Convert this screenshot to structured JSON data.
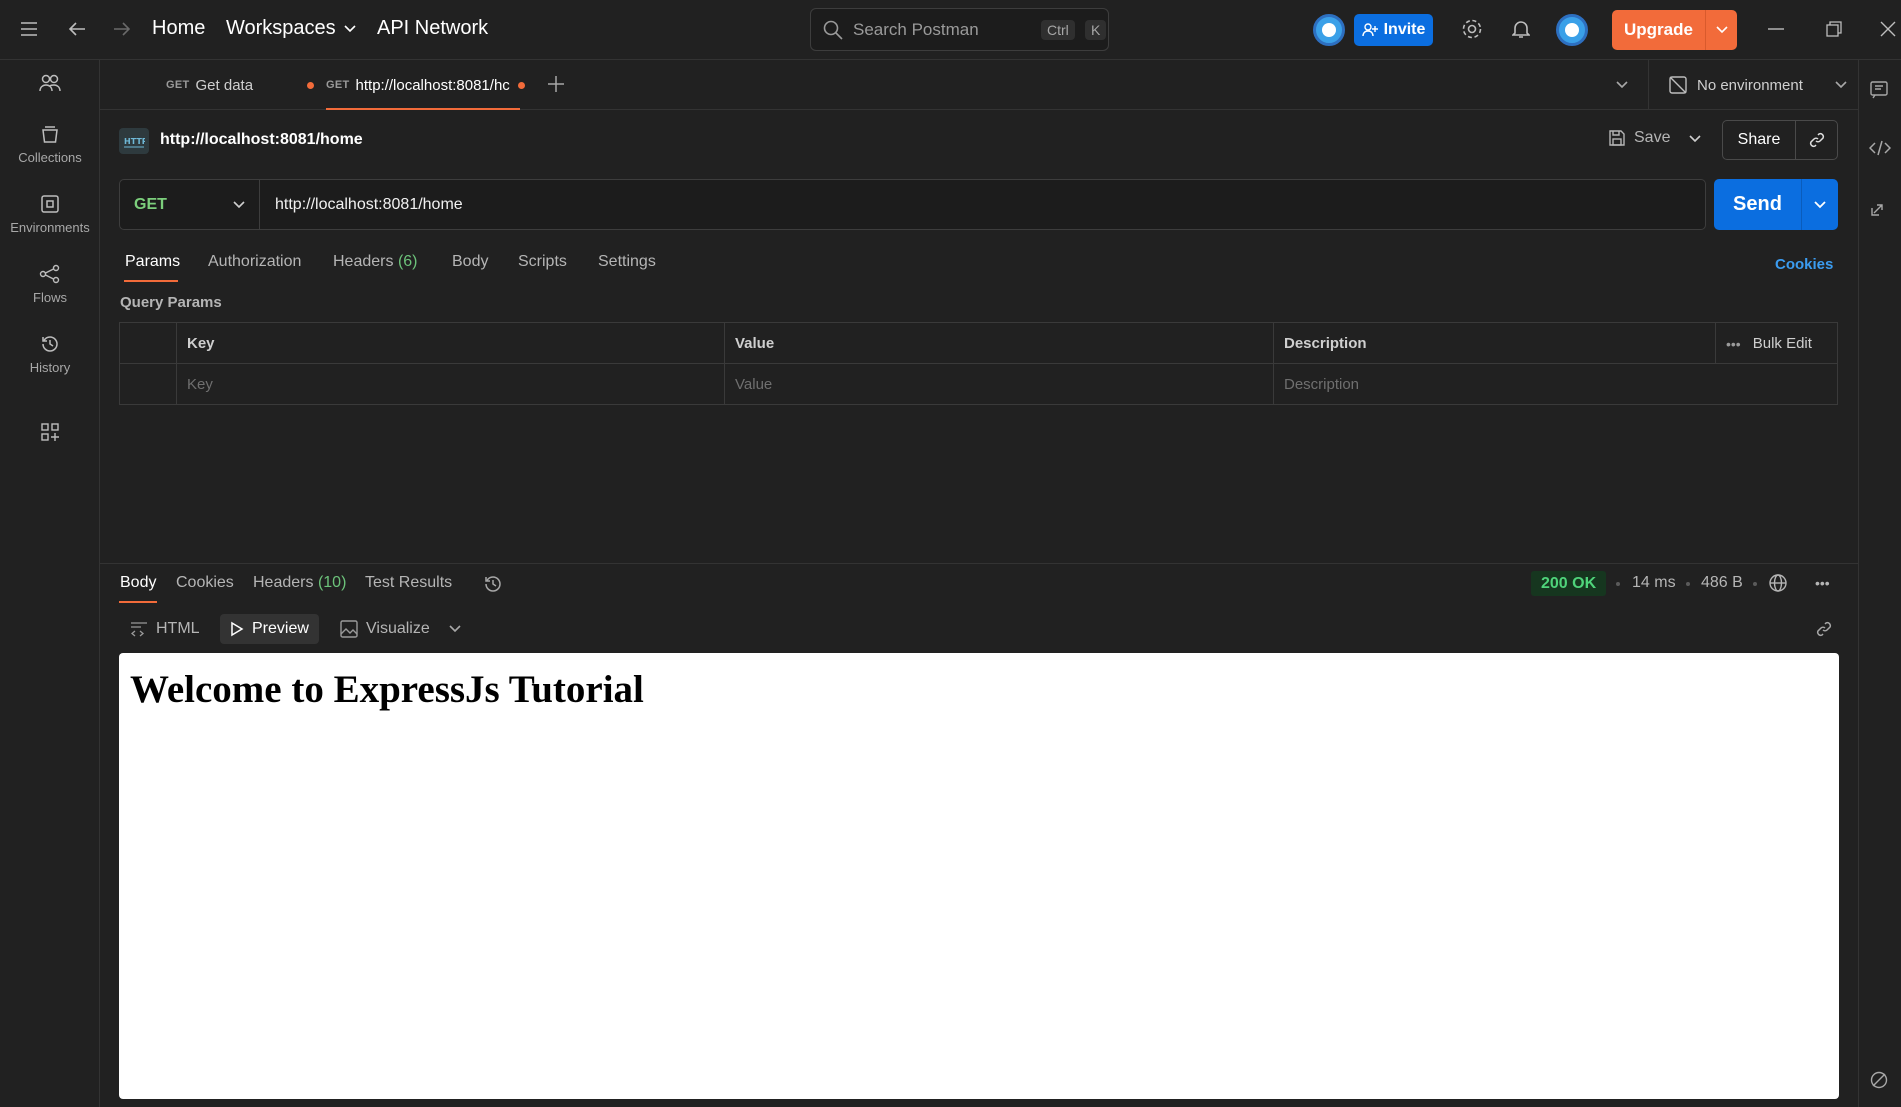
{
  "topbar": {
    "home": "Home",
    "workspaces": "Workspaces",
    "api_network": "API Network",
    "search_placeholder": "Search Postman",
    "search_kbd_ctrl": "Ctrl",
    "search_kbd_k": "K",
    "invite": "Invite",
    "upgrade": "Upgrade"
  },
  "sidebar": {
    "items": [
      {
        "label": "Collections",
        "icon": "collections-icon"
      },
      {
        "label": "Environments",
        "icon": "environments-icon"
      },
      {
        "label": "Flows",
        "icon": "flows-icon"
      },
      {
        "label": "History",
        "icon": "history-icon"
      }
    ]
  },
  "tabs": [
    {
      "method": "GET",
      "label": "Get data",
      "unsaved": true
    },
    {
      "method": "GET",
      "label": "http://localhost:8081/hc",
      "unsaved": true,
      "active": true
    }
  ],
  "environment": "No environment",
  "request": {
    "title": "http://localhost:8081/home",
    "save": "Save",
    "share": "Share",
    "method": "GET",
    "url": "http://localhost:8081/home",
    "send": "Send",
    "tabs": {
      "params": "Params",
      "authorization": "Authorization",
      "headers": "Headers",
      "headers_count": "(6)",
      "body": "Body",
      "scripts": "Scripts",
      "settings": "Settings",
      "cookies": "Cookies"
    },
    "query_params_title": "Query Params",
    "table": {
      "headers": [
        "Key",
        "Value",
        "Description"
      ],
      "bulk_edit": "Bulk Edit",
      "placeholders": [
        "Key",
        "Value",
        "Description"
      ]
    }
  },
  "response": {
    "tabs": {
      "body": "Body",
      "cookies": "Cookies",
      "headers": "Headers",
      "headers_count": "(10)",
      "test_results": "Test Results"
    },
    "status": "200 OK",
    "time": "14 ms",
    "size": "486 B",
    "views": {
      "html": "HTML",
      "preview": "Preview",
      "visualize": "Visualize"
    },
    "preview_heading": "Welcome to ExpressJs Tutorial"
  },
  "colors": {
    "accent": "#f26b3a",
    "primary": "#0b6ee0",
    "status_ok": "#4fd37a"
  }
}
